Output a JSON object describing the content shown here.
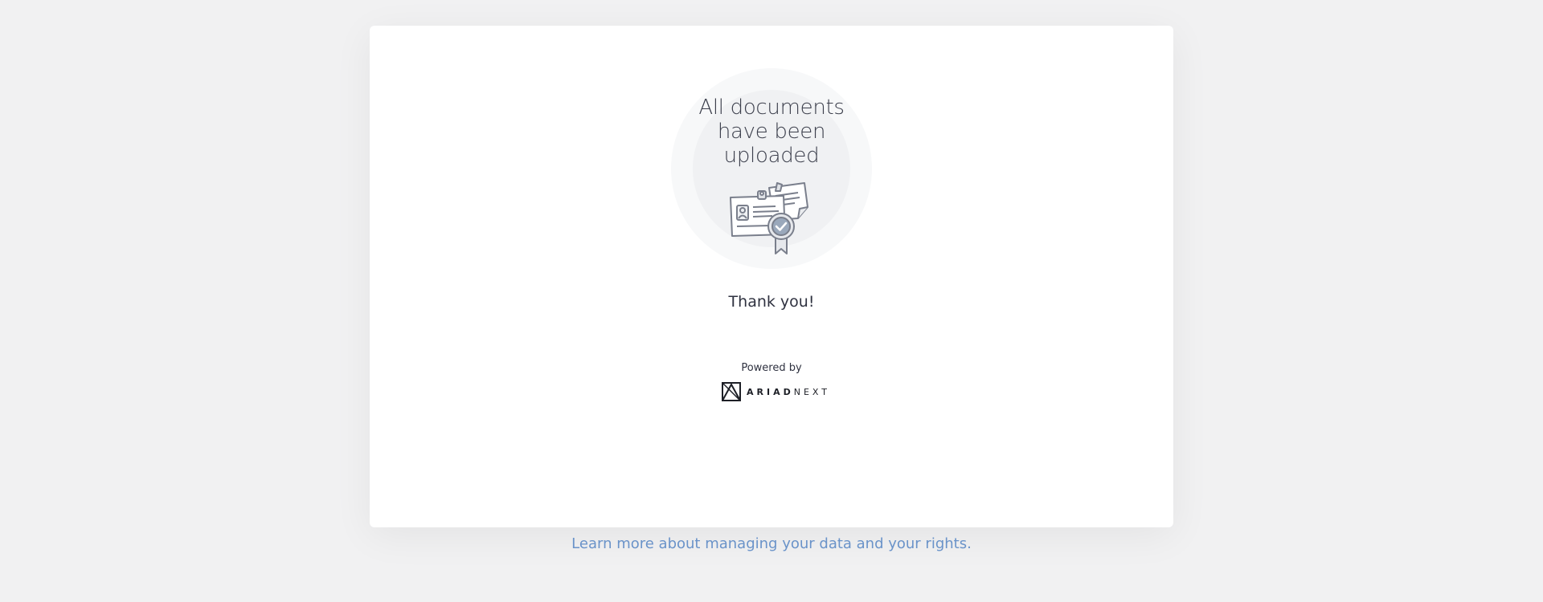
{
  "status": {
    "title": "All documents\nhave been\nuploaded",
    "illustration": "id-card-and-certificate-icon"
  },
  "confirmation": {
    "message": "Thank you!"
  },
  "branding": {
    "powered_by_label": "Powered by",
    "brand_name_strong": "ARIAD",
    "brand_name_light": "NEXT",
    "logo_icon": "ariadnext-logo-icon"
  },
  "footer": {
    "privacy_link": "Learn more about managing your data and your rights."
  },
  "colors": {
    "background": "#f1f1f2",
    "card": "#ffffff",
    "link": "#6a93c9",
    "text": "#2f3240"
  }
}
